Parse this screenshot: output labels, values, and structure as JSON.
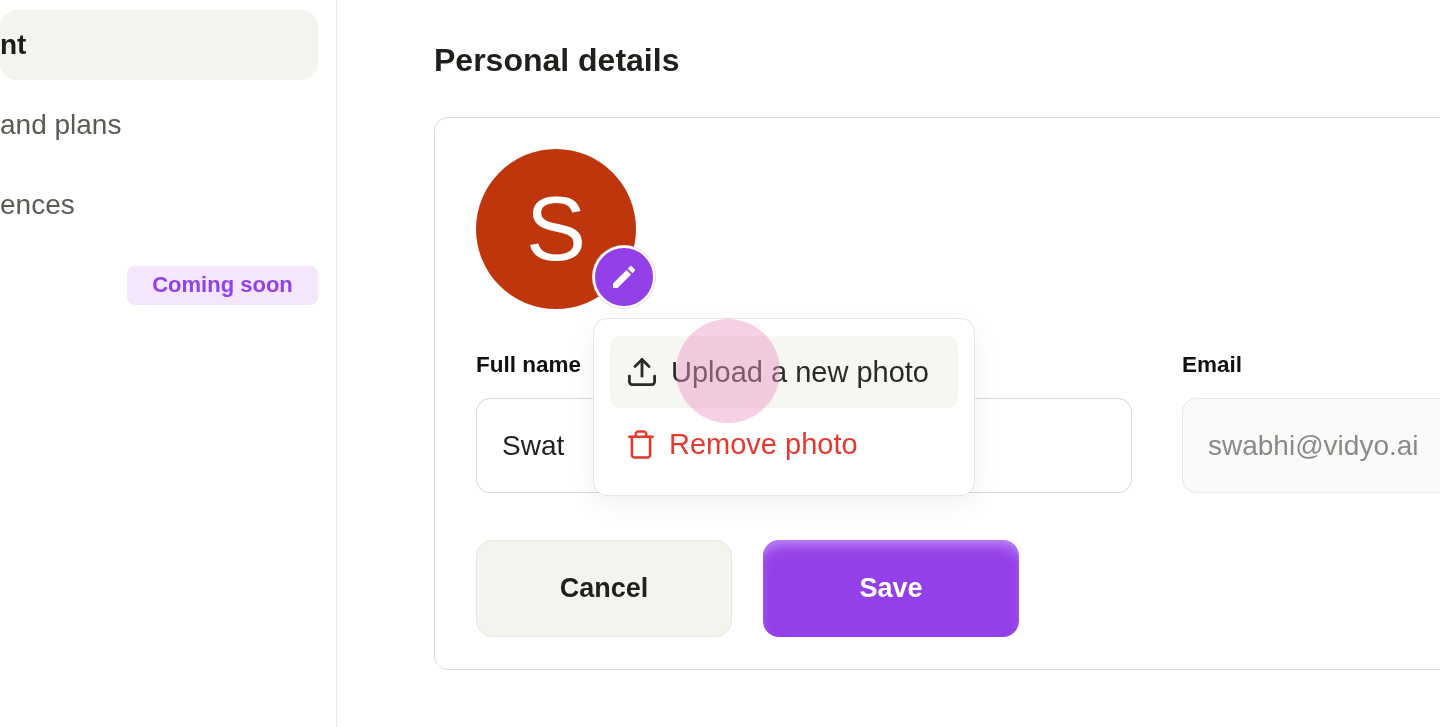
{
  "sidebar": {
    "items": [
      {
        "label": "nt",
        "selected": true
      },
      {
        "label": "and plans",
        "selected": false
      },
      {
        "label": "ences",
        "selected": false
      },
      {
        "badge": "Coming soon",
        "selected": false
      }
    ]
  },
  "title": "Personal details",
  "avatar": {
    "initial": "S"
  },
  "photo_menu": {
    "open": true,
    "items": [
      {
        "kind": "upload",
        "label": "Upload a new photo",
        "highlighted": true
      },
      {
        "kind": "remove",
        "label": "Remove photo",
        "highlighted": false
      }
    ]
  },
  "fields": [
    {
      "label": "Full name",
      "value": "Swat",
      "disabled": false
    },
    {
      "label": "Email",
      "value": "swabhi@vidyo.ai",
      "disabled": true
    }
  ],
  "buttons": [
    {
      "kind": "secondary",
      "label": "Cancel"
    },
    {
      "kind": "primary",
      "label": "Save"
    }
  ]
}
